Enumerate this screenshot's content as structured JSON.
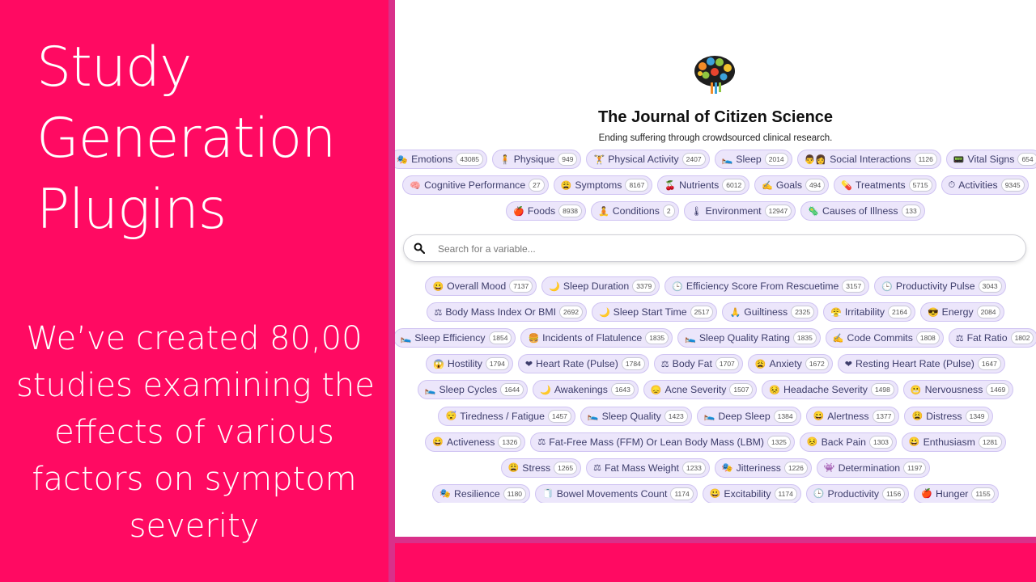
{
  "slide": {
    "title_lines": [
      "Study",
      "Generation",
      "Plugins"
    ],
    "body_lines": [
      "We’ve created 80,00",
      "studies examining the",
      "effects of various",
      "factors on symptom",
      "severity"
    ]
  },
  "journal": {
    "title": "The Journal of Citizen Science",
    "subtitle": "Ending suffering through crowdsourced clinical research."
  },
  "search": {
    "placeholder": "Search for a variable..."
  },
  "categories": [
    {
      "icon": "🎭",
      "label": "Emotions",
      "count": "43085"
    },
    {
      "icon": "🧍",
      "label": "Physique",
      "count": "949"
    },
    {
      "icon": "🏋",
      "label": "Physical Activity",
      "count": "2407"
    },
    {
      "icon": "🛌",
      "label": "Sleep",
      "count": "2014"
    },
    {
      "icon": "👨‍👩",
      "label": "Social Interactions",
      "count": "1126"
    },
    {
      "icon": "📟",
      "label": "Vital Signs",
      "count": "654"
    },
    {
      "icon": "🧠",
      "label": "Cognitive Performance",
      "count": "27"
    },
    {
      "icon": "😩",
      "label": "Symptoms",
      "count": "8167"
    },
    {
      "icon": "🍒",
      "label": "Nutrients",
      "count": "6012"
    },
    {
      "icon": "✍",
      "label": "Goals",
      "count": "494"
    },
    {
      "icon": "💊",
      "label": "Treatments",
      "count": "5715"
    },
    {
      "icon": "⏱",
      "label": "Activities",
      "count": "9345"
    },
    {
      "icon": "🍎",
      "label": "Foods",
      "count": "8938"
    },
    {
      "icon": "🧘",
      "label": "Conditions",
      "count": "2"
    },
    {
      "icon": "🌡",
      "label": "Environment",
      "count": "12947"
    },
    {
      "icon": "🦠",
      "label": "Causes of Illness",
      "count": "133"
    }
  ],
  "variables": [
    {
      "icon": "😀",
      "label": "Overall Mood",
      "count": "7137"
    },
    {
      "icon": "🌙",
      "label": "Sleep Duration",
      "count": "3379"
    },
    {
      "icon": "🕒",
      "label": "Efficiency Score From Rescuetime",
      "count": "3157"
    },
    {
      "icon": "🕒",
      "label": "Productivity Pulse",
      "count": "3043"
    },
    {
      "icon": "⚖",
      "label": "Body Mass Index Or BMI",
      "count": "2692"
    },
    {
      "icon": "🌙",
      "label": "Sleep Start Time",
      "count": "2517"
    },
    {
      "icon": "🙏",
      "label": "Guiltiness",
      "count": "2325"
    },
    {
      "icon": "😤",
      "label": "Irritability",
      "count": "2164"
    },
    {
      "icon": "😎",
      "label": "Energy",
      "count": "2084"
    },
    {
      "icon": "🛌",
      "label": "Sleep Efficiency",
      "count": "1854"
    },
    {
      "icon": "🍔",
      "label": "Incidents of Flatulence",
      "count": "1835"
    },
    {
      "icon": "🛌",
      "label": "Sleep Quality Rating",
      "count": "1835"
    },
    {
      "icon": "✍",
      "label": "Code Commits",
      "count": "1808"
    },
    {
      "icon": "⚖",
      "label": "Fat Ratio",
      "count": "1802"
    },
    {
      "icon": "😱",
      "label": "Hostility",
      "count": "1794"
    },
    {
      "icon": "❤",
      "label": "Heart Rate (Pulse)",
      "count": "1784"
    },
    {
      "icon": "⚖",
      "label": "Body Fat",
      "count": "1707"
    },
    {
      "icon": "😩",
      "label": "Anxiety",
      "count": "1672"
    },
    {
      "icon": "❤",
      "label": "Resting Heart Rate (Pulse)",
      "count": "1647"
    },
    {
      "icon": "🛌",
      "label": "Sleep Cycles",
      "count": "1644"
    },
    {
      "icon": "🌙",
      "label": "Awakenings",
      "count": "1643"
    },
    {
      "icon": "😞",
      "label": "Acne Severity",
      "count": "1507"
    },
    {
      "icon": "😣",
      "label": "Headache Severity",
      "count": "1498"
    },
    {
      "icon": "😬",
      "label": "Nervousness",
      "count": "1469"
    },
    {
      "icon": "😴",
      "label": "Tiredness / Fatigue",
      "count": "1457"
    },
    {
      "icon": "🛌",
      "label": "Sleep Quality",
      "count": "1423"
    },
    {
      "icon": "🛌",
      "label": "Deep Sleep",
      "count": "1384"
    },
    {
      "icon": "😀",
      "label": "Alertness",
      "count": "1377"
    },
    {
      "icon": "😩",
      "label": "Distress",
      "count": "1349"
    },
    {
      "icon": "😀",
      "label": "Activeness",
      "count": "1326"
    },
    {
      "icon": "⚖",
      "label": "Fat-Free Mass (FFM) Or Lean Body Mass (LBM)",
      "count": "1325"
    },
    {
      "icon": "😣",
      "label": "Back Pain",
      "count": "1303"
    },
    {
      "icon": "😀",
      "label": "Enthusiasm",
      "count": "1281"
    },
    {
      "icon": "😩",
      "label": "Stress",
      "count": "1265"
    },
    {
      "icon": "⚖",
      "label": "Fat Mass Weight",
      "count": "1233"
    },
    {
      "icon": "🎭",
      "label": "Jitteriness",
      "count": "1226"
    },
    {
      "icon": "👾",
      "label": "Determination",
      "count": "1197"
    },
    {
      "icon": "🎭",
      "label": "Resilience",
      "count": "1180"
    },
    {
      "icon": "🧻",
      "label": "Bowel Movements Count",
      "count": "1174"
    },
    {
      "icon": "😀",
      "label": "Excitability",
      "count": "1174"
    },
    {
      "icon": "🕒",
      "label": "Productivity",
      "count": "1156"
    },
    {
      "icon": "🍎",
      "label": "Hunger",
      "count": "1155"
    }
  ],
  "colors": {
    "slide_bg": "#ff0a62",
    "chip_bg": "#ece6fb",
    "chip_border": "#cfc3f2"
  }
}
